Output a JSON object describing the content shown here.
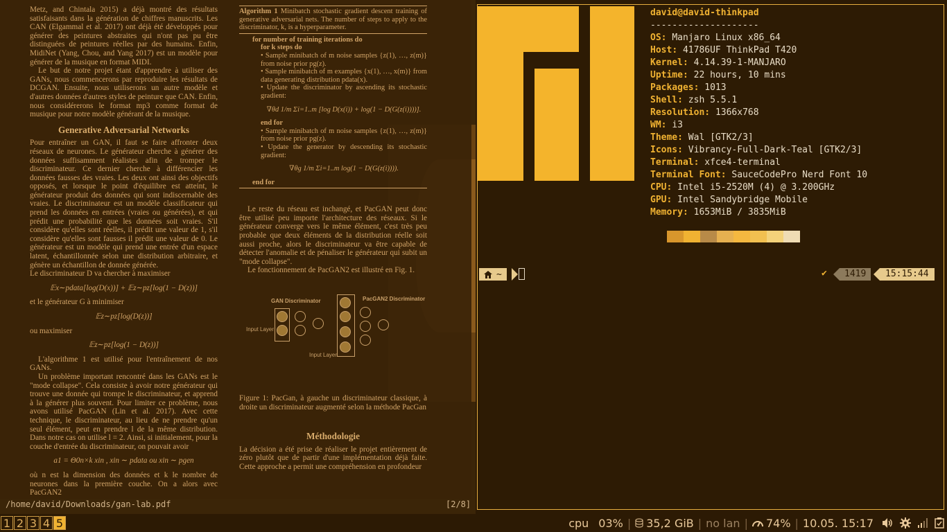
{
  "pdf": {
    "path": "/home/david/Downloads/gan-lab.pdf",
    "page_indicator": "[2/8]",
    "left_column": {
      "p1": "Metz, and Chintala 2015) a déjà montré des résultats satisfaisants dans la génération de chiffres manuscrits. Les CAN (Elgammal et al. 2017) ont déjà été développés pour générer des peintures abstraites qui n'ont pas pu être distinguées de peintures réelles par des humains. Enfin, MidiNet (Yang, Chou, and Yang 2017) est un modèle pour générer de la musique en format MIDI.",
      "p2": "Le but de notre projet étant d'apprendre à utiliser des GANs, nous commencerons par reproduire les résultats de DCGAN. Ensuite, nous utiliserons un autre modèle et d'autres données d'autres styles de peinture que CAN. Enfin, nous considérerons le format mp3 comme format de musique pour notre modèle générant de la musique.",
      "heading": "Generative Adversarial Networks",
      "p3": "Pour entraîner un GAN, il faut se faire affronter deux réseaux de neurones. Le générateur cherche à générer des données suffisamment réalistes afin de tromper le discriminateur. Ce dernier cherche à différencier les données fausses des vraies. Les deux ont ainsi des objectifs opposés, et lorsque le point d'équilibre est atteint, le générateur produit des données qui sont indiscernable des vraies. Le discriminateur est un modèle classificateur qui prend les données en entrées (vraies ou générées), et qui prédit une probabilité que les données soit vraies. S'il considère qu'elles sont réelles, il prédit une valeur de 1, s'il considère qu'elles sont fausses il prédit une valeur de 0. Le générateur est un modèle qui prend une entrée d'un espace latent, échantillonnée selon une distribution arbitraire, et génère un échantillon de donnée générée.",
      "p4": "Le discriminateur D va chercher à maximiser",
      "eq1": "𝔼x∼pdata[log(D(x))] + 𝔼z∼pz[log(1 − D(z))]",
      "p5": "et le générateur G à minimiser",
      "eq2": "𝔼z∼pz[log(D(z))]",
      "p6": "ou maximiser",
      "eq3": "𝔼z∼pz[log(1 − D(z))]",
      "p7": "L'algorithme 1 est utilisé pour l'entraînement de nos GANs.",
      "p8": "Un problème important rencontré dans les GANs est le \"mode collapse\". Cela consiste à avoir notre générateur qui trouve une donnée qui trompe le discriminateur, et apprend à la générer plus souvent. Pour limiter ce problème, nous avons utilisé PacGAN (Lin et al. 2017). Avec cette technique, le discriminateur, au lieu de ne prendre qu'un seul élément, peut en prendre l de la même distribution. Dans notre cas on utilise l = 2. Ainsi, si initialement, pour la couche d'entrée du discriminateur, on pouvait avoir",
      "eq4": "a1 = Θ0n×k xin , xin ∼ pdata ou xin ∼ pgen",
      "p9": "où n est la dimension des données et k le nombre de neurones dans la première couche. On a alors avec PacGAN2"
    },
    "right_column": {
      "algo_title": "Algorithm 1",
      "algo_caption": "Minibatch stochastic gradient descent training of generative adversarial nets. The number of steps to apply to the discriminator, k, is a hyperparameter.",
      "line1": "for number of training iterations do",
      "line2": "for k steps do",
      "line3": "• Sample minibatch of m noise samples {z(1), …, z(m)} from noise prior pg(z).",
      "line4": "• Sample minibatch of m examples {x(1), …, x(m)} from data generating distribution pdata(x).",
      "line5": "• Update the discriminator by ascending its stochastic gradient:",
      "eq_d": "∇θd 1/m Σi=1..m [log D(x(i)) + log(1 − D(G(z(i))))].",
      "line6": "end for",
      "line7": "• Sample minibatch of m noise samples {z(1), …, z(m)} from noise prior pg(z).",
      "line8": "• Update the generator by descending its stochastic gradient:",
      "eq_g": "∇θg 1/m Σi=1..m log(1 − D(G(z(i)))).",
      "line9": "end for",
      "p1": "Le reste du réseau est inchangé, et PacGAN peut donc être utilisé peu importe l'architecture des réseaux. Si le générateur converge vers le même élément, c'est très peu probable que deux éléments de la distribution réelle soit aussi proche, alors le discriminateur va être capable de détecter l'anomalie et de pénaliser le générateur qui subit un \"mode collapse\".",
      "p2": "Le fonctionnement de PacGAN2 est illustré en Fig. 1.",
      "fig_label_gan": "GAN Discriminator",
      "fig_label_pac": "PacGAN2 Discriminator",
      "fig_label_input1": "Input Layer",
      "fig_label_input2": "Input Layer",
      "fig_caption": "Figure 1: PacGan, à gauche un discriminateur classique, à droite un discriminateur augmenté selon la méthode PacGan",
      "heading": "Méthodologie",
      "p3": "La décision a été prise de réaliser le projet entièrement de zéro plutôt que de partir d'une implémentation déjà faite. Cette approche a permit une compréhension en profondeur"
    }
  },
  "terminal": {
    "user_host": "david@david-thinkpad",
    "separator": "--------------------",
    "info": [
      {
        "key": "OS",
        "value": "Manjaro Linux x86_64"
      },
      {
        "key": "Host",
        "value": "41786UF ThinkPad T420"
      },
      {
        "key": "Kernel",
        "value": "4.14.39-1-MANJARO"
      },
      {
        "key": "Uptime",
        "value": "22 hours, 10 mins"
      },
      {
        "key": "Packages",
        "value": "1013"
      },
      {
        "key": "Shell",
        "value": "zsh 5.5.1"
      },
      {
        "key": "Resolution",
        "value": "1366x768"
      },
      {
        "key": "WM",
        "value": "i3"
      },
      {
        "key": "Theme",
        "value": "Wal [GTK2/3]"
      },
      {
        "key": "Icons",
        "value": "Vibrancy-Full-Dark-Teal [GTK2/3]"
      },
      {
        "key": "Terminal",
        "value": "xfce4-terminal"
      },
      {
        "key": "Terminal Font",
        "value": "SauceCodePro Nerd Font 10"
      },
      {
        "key": "CPU",
        "value": "Intel i5-2520M (4) @ 3.200GHz"
      },
      {
        "key": "GPU",
        "value": "Intel Sandybridge Mobile"
      },
      {
        "key": "Memory",
        "value": "1653MiB / 3835MiB"
      }
    ],
    "palette": [
      "#d8962c",
      "#f0b232",
      "#b88a48",
      "#e6b050",
      "#f4b840",
      "#f2c050",
      "#f4d27a",
      "#efdcb4"
    ],
    "logo_color": "#f4b42c",
    "prompt": {
      "home_icon": "home-icon",
      "dir": "~",
      "status_check": "✔",
      "history_number": "1419",
      "time": "15:15:44"
    }
  },
  "bar": {
    "workspaces": [
      "1",
      "2",
      "3",
      "4",
      "5"
    ],
    "active_workspace": "5",
    "cpu_label": "cpu",
    "cpu_value": "03%",
    "disk_value": "35,2 GiB",
    "network": "no lan",
    "battery": "74%",
    "datetime": "10.05. 15:17",
    "accent": "#f0b232"
  }
}
